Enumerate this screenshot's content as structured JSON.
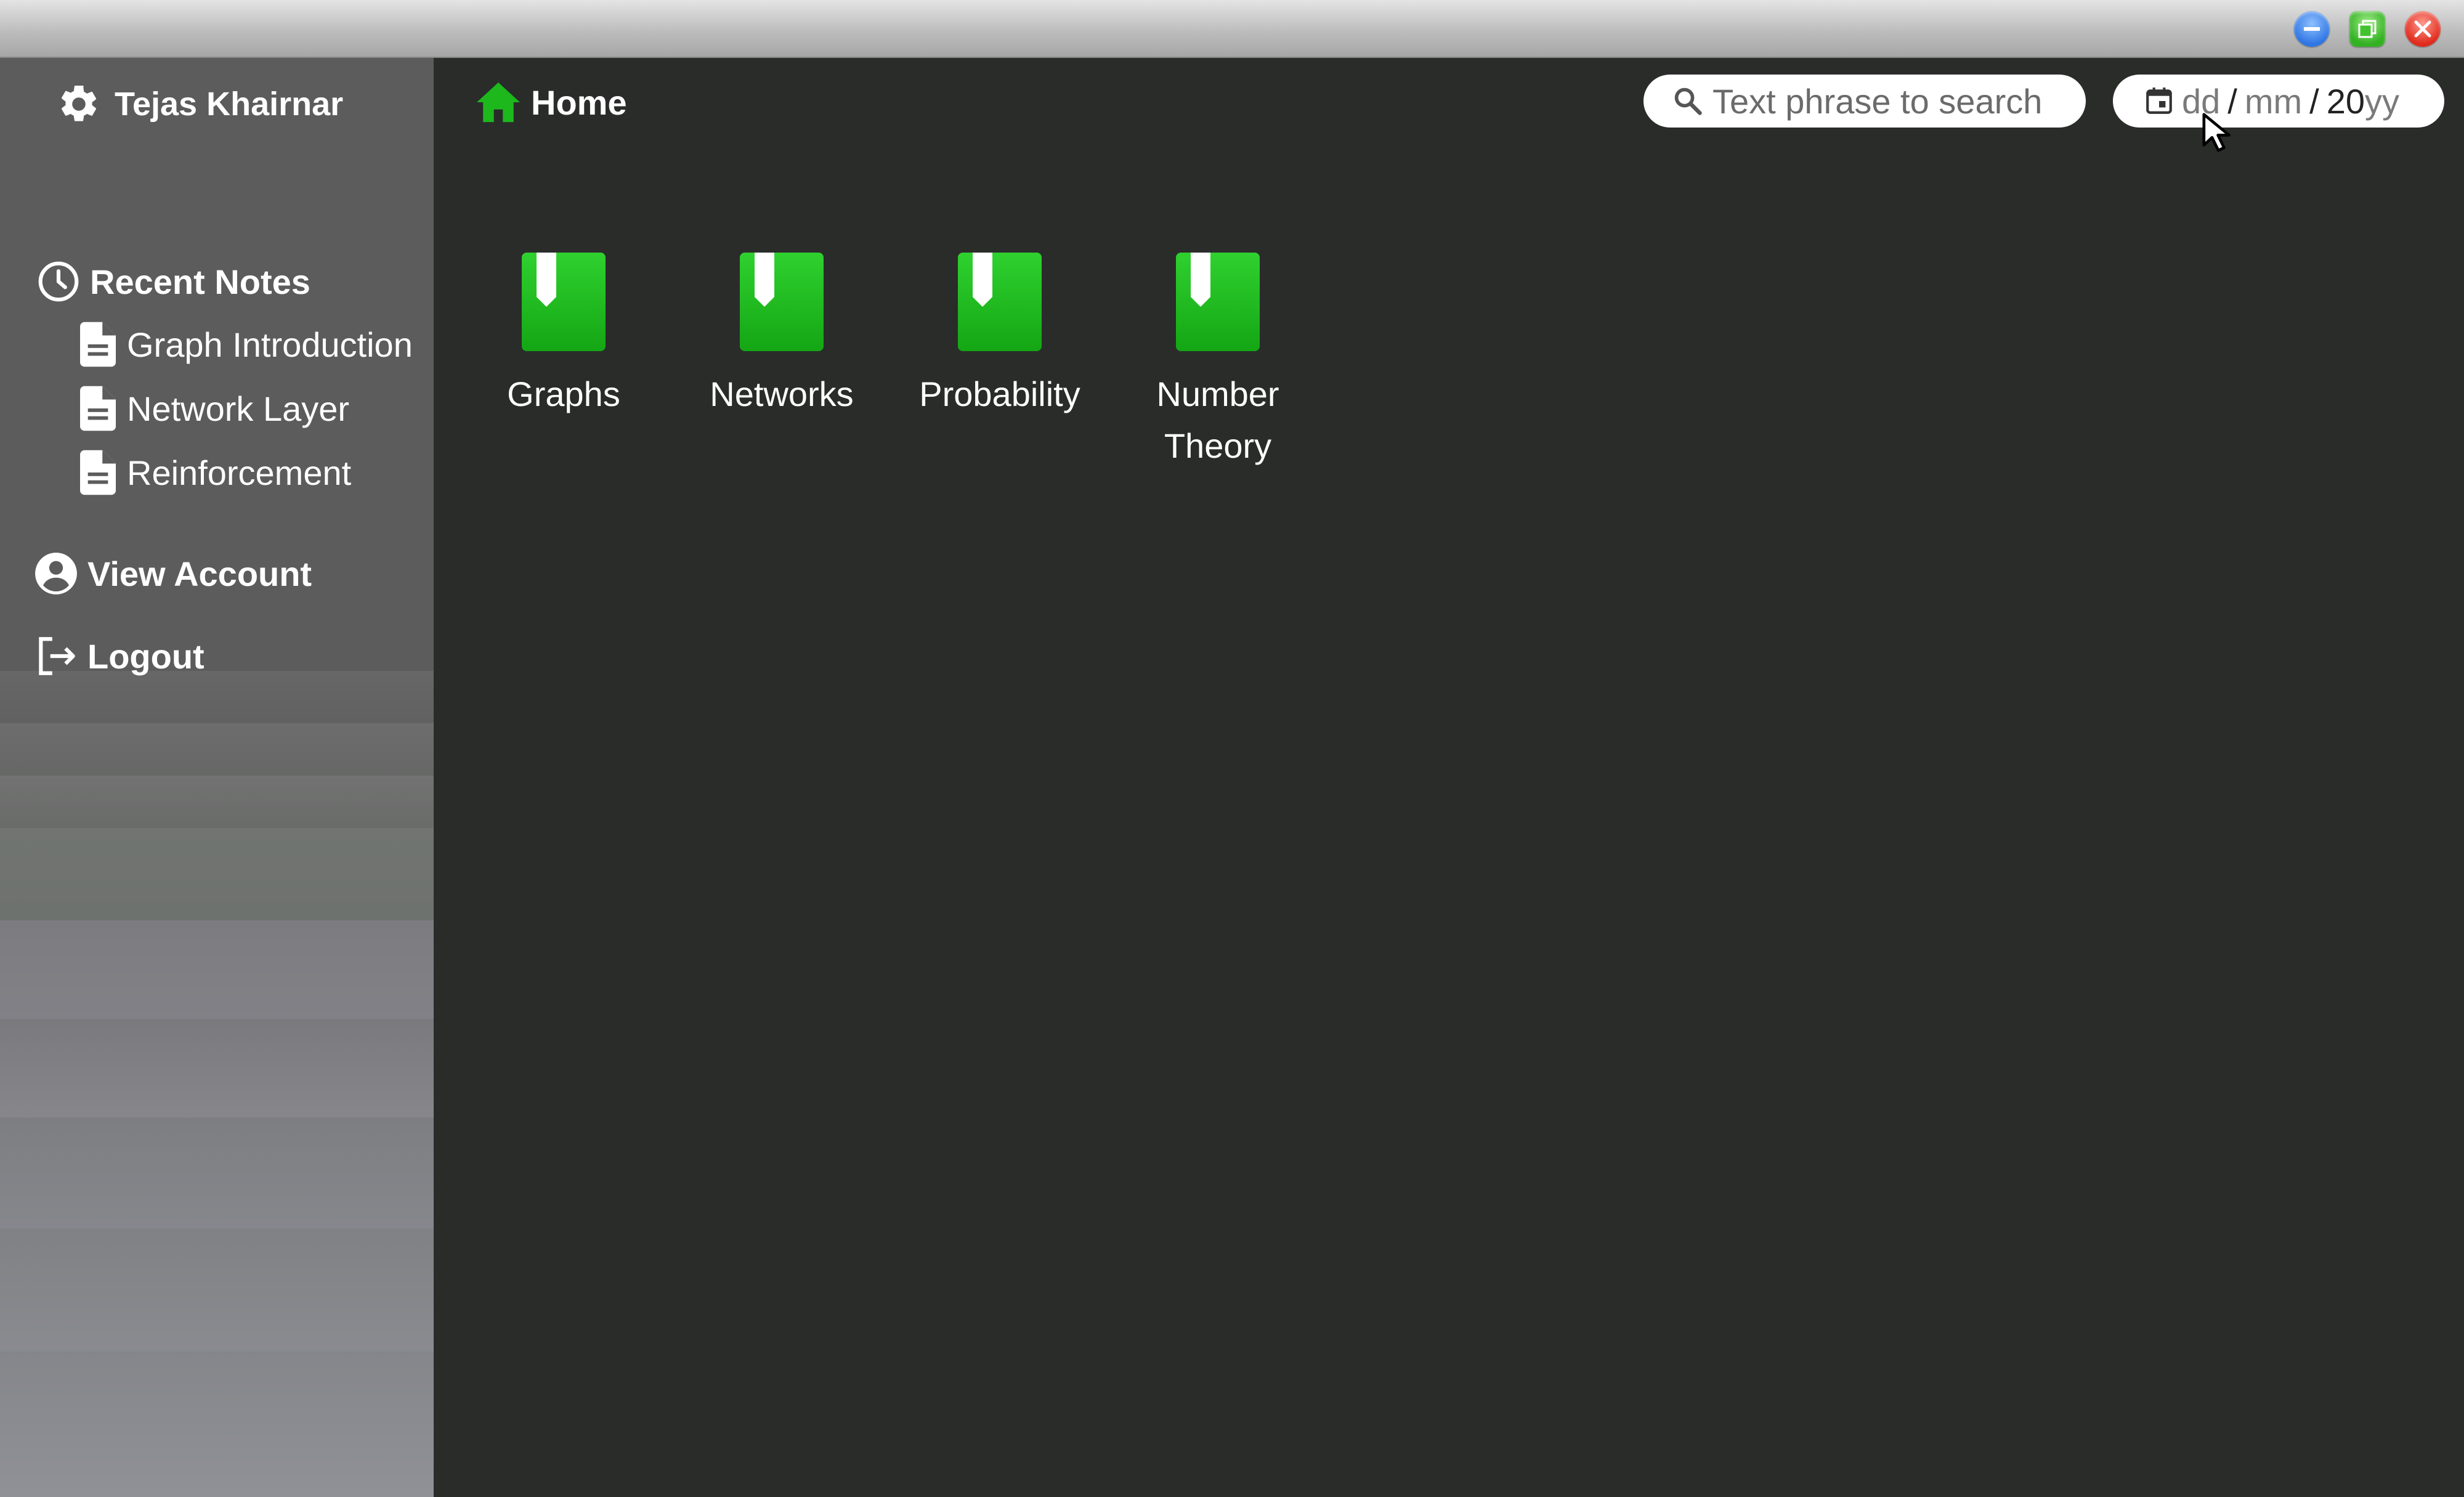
{
  "window": {
    "controls": [
      "minimize-icon",
      "maximize-icon",
      "close-icon"
    ],
    "colors": {
      "minimize": "#2f76e3",
      "maximize": "#34b123",
      "close": "#e02a1c"
    }
  },
  "sidebar": {
    "user_name": "Tejas Khairnar",
    "recent_notes_label": "Recent Notes",
    "recent_notes": [
      {
        "label": "Graph Introduction",
        "icon": "document-icon"
      },
      {
        "label": "Network Layer",
        "icon": "document-icon"
      },
      {
        "label": "Reinforcement",
        "icon": "document-icon"
      }
    ],
    "view_account_label": "View Account",
    "logout_label": "Logout"
  },
  "header": {
    "home_label": "Home",
    "search_placeholder": "Text phrase to search",
    "date": {
      "day": "dd",
      "month": "mm",
      "year_prefix": "20",
      "year_suffix": "yy",
      "separator": "/"
    }
  },
  "notebooks": [
    {
      "label": "Graphs"
    },
    {
      "label": "Networks"
    },
    {
      "label": "Probability"
    },
    {
      "label": "Number\nTheory"
    }
  ],
  "colors": {
    "accent": "#1cb81c",
    "main_bg": "#2a2c2a",
    "sidebar_bg": "#5c5c5c"
  }
}
